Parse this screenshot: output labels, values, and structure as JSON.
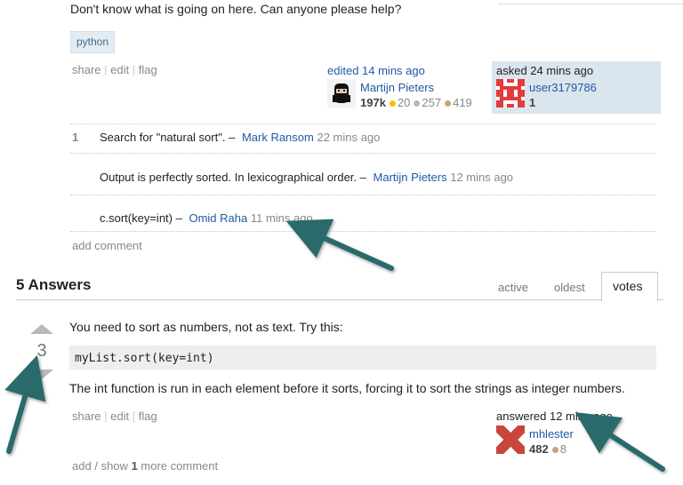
{
  "question": {
    "body_tail": "Don't know what is going on here. Can anyone please help?",
    "tag": "python",
    "menu": {
      "share": "share",
      "edit": "edit",
      "flag": "flag",
      "sep": "|"
    },
    "edited": {
      "label": "edited 14 mins ago",
      "user": "Martijn Pieters",
      "rep": "197k",
      "gold": "20",
      "silver": "257",
      "bronze": "419"
    },
    "asked": {
      "label": "asked 24 mins ago",
      "user": "user3179786",
      "rep": "1"
    }
  },
  "comments": [
    {
      "score": "1",
      "text": "Search for \"natural sort\". –",
      "user": "Mark Ransom",
      "time": "22 mins ago"
    },
    {
      "score": "",
      "text": "Output is perfectly sorted. In lexicographical order. –",
      "user": "Martijn Pieters",
      "time": "12 mins ago"
    },
    {
      "score": "",
      "text": "c.sort(key=int) –",
      "user": "Omid Raha",
      "time": "11 mins ago"
    }
  ],
  "add_comment": "add comment",
  "answers": {
    "header": "5 Answers",
    "tabs": [
      "active",
      "oldest",
      "votes"
    ],
    "active_tab": "votes"
  },
  "answer": {
    "votes": "3",
    "text1": "You need to sort as numbers, not as text. Try this:",
    "code": "myList.sort(key=int)",
    "text2": "The int function is run in each element before it sorts, forcing it to sort the strings as integer numbers.",
    "menu": {
      "share": "share",
      "edit": "edit",
      "flag": "flag",
      "sep": "|"
    },
    "answered": {
      "label": "answered 12 mins ago",
      "user": "mhlester",
      "rep": "482",
      "bronze": "8"
    },
    "more": {
      "add": "add",
      "sep": "/",
      "show": "show",
      "count": "1",
      "more": "more comment"
    }
  },
  "colors": {
    "link": "#1f5aa3",
    "arrow": "#2a6b6b",
    "asked_bg": "#dae5ee"
  }
}
